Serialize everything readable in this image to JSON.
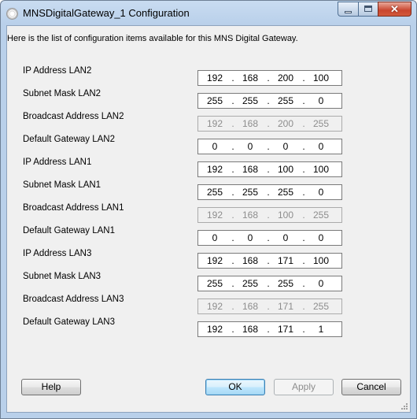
{
  "window": {
    "title": "MNSDigitalGateway_1 Configuration",
    "close_glyph": "✕"
  },
  "intro_text": "Here is the list of configuration items available for this MNS Digital Gateway.",
  "rows": [
    {
      "label": "IP Address LAN2",
      "octets": [
        "192",
        "168",
        "200",
        "100"
      ],
      "enabled": true
    },
    {
      "label": "Subnet Mask LAN2",
      "octets": [
        "255",
        "255",
        "255",
        "0"
      ],
      "enabled": true
    },
    {
      "label": "Broadcast Address LAN2",
      "octets": [
        "192",
        "168",
        "200",
        "255"
      ],
      "enabled": false
    },
    {
      "label": "Default Gateway LAN2",
      "octets": [
        "0",
        "0",
        "0",
        "0"
      ],
      "enabled": true
    },
    {
      "label": "IP Address LAN1",
      "octets": [
        "192",
        "168",
        "100",
        "100"
      ],
      "enabled": true
    },
    {
      "label": "Subnet Mask LAN1",
      "octets": [
        "255",
        "255",
        "255",
        "0"
      ],
      "enabled": true
    },
    {
      "label": "Broadcast Address LAN1",
      "octets": [
        "192",
        "168",
        "100",
        "255"
      ],
      "enabled": false
    },
    {
      "label": "Default Gateway LAN1",
      "octets": [
        "0",
        "0",
        "0",
        "0"
      ],
      "enabled": true
    },
    {
      "label": "IP Address LAN3",
      "octets": [
        "192",
        "168",
        "171",
        "100"
      ],
      "enabled": true
    },
    {
      "label": "Subnet Mask LAN3",
      "octets": [
        "255",
        "255",
        "255",
        "0"
      ],
      "enabled": true
    },
    {
      "label": "Broadcast Address LAN3",
      "octets": [
        "192",
        "168",
        "171",
        "255"
      ],
      "enabled": false
    },
    {
      "label": "Default Gateway LAN3",
      "octets": [
        "192",
        "168",
        "171",
        "1"
      ],
      "enabled": true
    }
  ],
  "buttons": {
    "help": "Help",
    "ok": "OK",
    "apply": "Apply",
    "cancel": "Cancel"
  },
  "colors": {
    "title_bar": "#b9d0ea",
    "dialog_bg": "#f0f0f0",
    "disabled_text": "#8d8d8d",
    "close_button": "#c9452e"
  }
}
